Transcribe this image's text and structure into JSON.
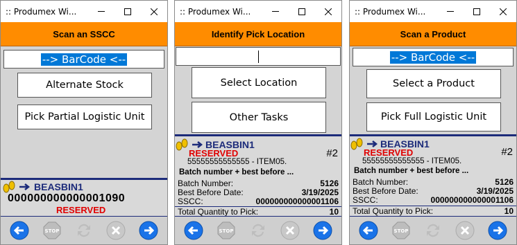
{
  "windows": [
    {
      "title": ":: Produmex Wi...",
      "header": "Scan an SSCC",
      "barcode_value": "--> BarCode <--",
      "buttons": [
        "Alternate Stock",
        "Pick Partial Logistic Unit"
      ],
      "info": {
        "bin": "BEASBIN1",
        "sscc": "000000000000001090",
        "status": "RESERVED"
      }
    },
    {
      "title": ":: Produmex Wi...",
      "header": "Identify Pick Location",
      "barcode_value": "",
      "buttons": [
        "Select Location",
        "Other Tasks"
      ],
      "info": {
        "bin": "BEASBIN1",
        "status": "RESERVED",
        "item": "55555555555555 - ITEM05.",
        "seq": "#2",
        "batch_title": "Batch number + best before ...",
        "batch_label": "Batch Number:",
        "batch_value": "5126",
        "bbd_label": "Best Before Date:",
        "bbd_value": "3/19/2025",
        "sscc_label": "SSCC:",
        "sscc_value": "000000000000001106",
        "qty_label": "Total Quantity to Pick:",
        "qty_value": "10"
      }
    },
    {
      "title": ":: Produmex Wi...",
      "header": "Scan a Product",
      "barcode_value": "--> BarCode <--",
      "buttons": [
        "Select a Product",
        "Pick Full Logistic Unit"
      ],
      "info": {
        "bin": "BEASBIN1",
        "status": "RESERVED",
        "item": "55555555555555 - ITEM05.",
        "seq": "#2",
        "batch_title": "Batch number + best before ...",
        "batch_label": "Batch Number:",
        "batch_value": "5126",
        "bbd_label": "Best Before Date:",
        "bbd_value": "3/19/2025",
        "sscc_label": "SSCC:",
        "sscc_value": "000000000000001106",
        "qty_label": "Total Quantity to Pick:",
        "qty_value": "10"
      }
    }
  ],
  "nav_icons": [
    "back-arrow-icon",
    "stop-icon",
    "refresh-icon",
    "cancel-icon",
    "forward-arrow-icon"
  ],
  "nav_stop_label": "STOP",
  "colors": {
    "header": "#ff8c00",
    "accent_blue": "#1c2b7a",
    "reserved": "#e00000",
    "nav_blue": "#1a73e8"
  }
}
